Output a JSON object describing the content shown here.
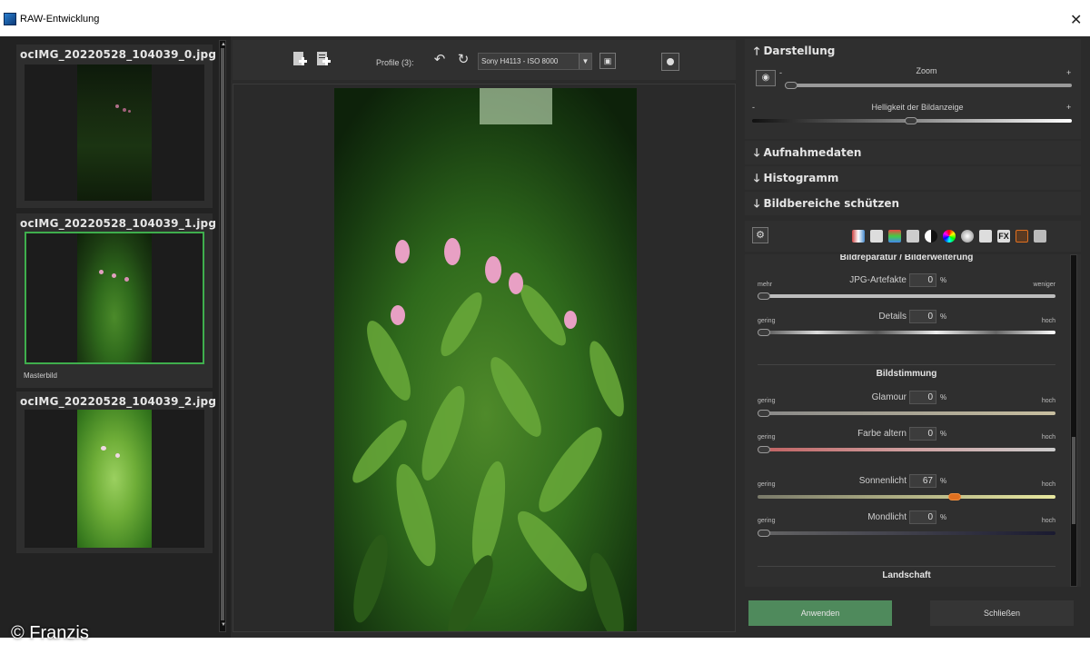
{
  "window": {
    "title": "RAW-Entwicklung",
    "close_icon": "✕"
  },
  "thumbnails": [
    {
      "filename": "ocIMG_20220528_104039_0.jpg",
      "caption": "",
      "selected": false
    },
    {
      "filename": "ocIMG_20220528_104039_1.jpg",
      "caption": "Masterbild",
      "selected": true
    },
    {
      "filename": "ocIMG_20220528_104039_2.jpg",
      "caption": "",
      "selected": false
    }
  ],
  "toolbar": {
    "profile_label": "Profile (3):",
    "profile_value": "Sony H4113 - ISO 8000",
    "dropdown_icon": "▼",
    "save_icon": "▣"
  },
  "darstellung": {
    "header": "Darstellung",
    "header_icon": "🡑",
    "zoom_label": "Zoom",
    "minus": "-",
    "plus": "+",
    "brightness_label": "Helligkeit der Bildanzeige",
    "zoom_level": 0.0,
    "brightness_level": 0.5
  },
  "sections": {
    "aufnahmedaten": "Aufnahmedaten",
    "histogramm": "Histogramm",
    "bildbereiche": "Bildbereiche schützen",
    "collapsed_icon": "🡓"
  },
  "adjust": {
    "reparatur_title": "Bildreparatur / Bilderweiterung",
    "jpg": {
      "label": "JPG-Artefakte",
      "value": "0",
      "unit": "%",
      "low": "mehr",
      "high": "weniger"
    },
    "details": {
      "label": "Details",
      "value": "0",
      "unit": "%",
      "low": "gering",
      "high": "hoch"
    },
    "stimmung_title": "Bildstimmung",
    "glamour": {
      "label": "Glamour",
      "value": "0",
      "unit": "%",
      "low": "gering",
      "high": "hoch"
    },
    "farbe": {
      "label": "Farbe altern",
      "value": "0",
      "unit": "%",
      "low": "gering",
      "high": "hoch"
    },
    "sonne": {
      "label": "Sonnenlicht",
      "value": "67",
      "unit": "%",
      "low": "gering",
      "high": "hoch"
    },
    "mond": {
      "label": "Mondlicht",
      "value": "0",
      "unit": "%",
      "low": "gering",
      "high": "hoch"
    },
    "landschaft_title": "Landschaft"
  },
  "buttons": {
    "apply": "Anwenden",
    "close": "Schließen"
  },
  "watermark": "© Franzis",
  "colors": {
    "accent_green": "#4f8a5c",
    "slider_active": "#e07020"
  }
}
